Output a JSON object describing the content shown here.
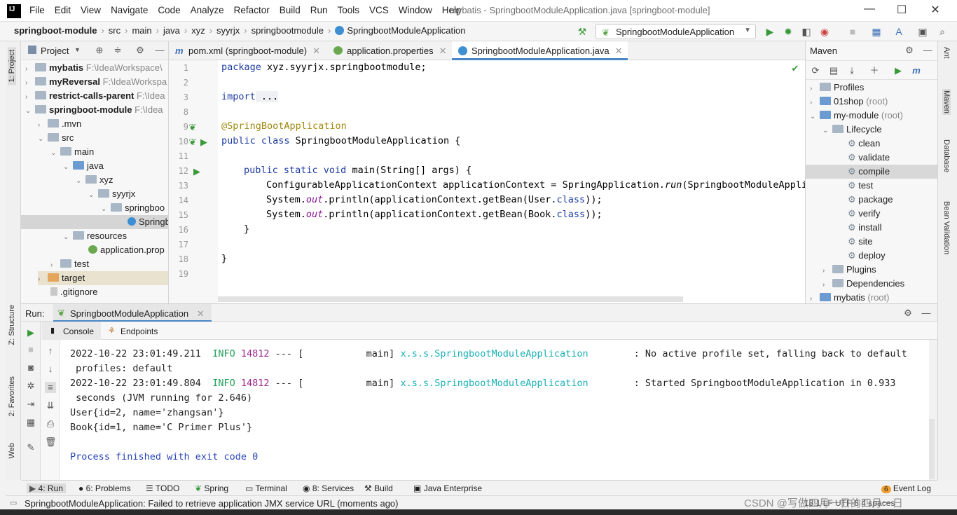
{
  "window": {
    "title": "mybatis - SpringbootModuleApplication.java [springboot-module]",
    "menu": [
      "File",
      "Edit",
      "View",
      "Navigate",
      "Code",
      "Analyze",
      "Refactor",
      "Build",
      "Run",
      "Tools",
      "VCS",
      "Window",
      "Help"
    ]
  },
  "breadcrumbs": [
    "springboot-module",
    "src",
    "main",
    "java",
    "xyz",
    "syyrjx",
    "springbootmodule",
    "SpringbootModuleApplication"
  ],
  "run_config": "SpringbootModuleApplication",
  "left_stripe": [
    "1: Project",
    "Z: Structure",
    "2: Favorites",
    "Web"
  ],
  "project": {
    "title": "Project",
    "rows": [
      {
        "label": "mybatis",
        "path": "F:\\IdeaWorkspace\\",
        "bold": true
      },
      {
        "label": "myReversal",
        "path": "F:\\IdeaWorkspa",
        "bold": true
      },
      {
        "label": "restrict-calls-parent",
        "path": "F:\\Idea",
        "bold": true
      },
      {
        "label": "springboot-module",
        "path": "F:\\Idea",
        "bold": true
      },
      {
        "label": ".mvn"
      },
      {
        "label": "src"
      },
      {
        "label": "main"
      },
      {
        "label": "java"
      },
      {
        "label": "xyz"
      },
      {
        "label": "syyrjx"
      },
      {
        "label": "springboo"
      },
      {
        "label": "Springb"
      },
      {
        "label": "resources"
      },
      {
        "label": "application.prop"
      },
      {
        "label": "test"
      },
      {
        "label": "target"
      },
      {
        "label": ".gitignore"
      }
    ]
  },
  "editor": {
    "tabs": [
      "pom.xml (springboot-module)",
      "application.properties",
      "SpringbootModuleApplication.java"
    ],
    "line_numbers": [
      "1",
      "2",
      "3",
      "8",
      "9",
      "10",
      "11",
      "12",
      "13",
      "14",
      "15",
      "16",
      "17",
      "18",
      "19"
    ],
    "code": {
      "l1_kw": "package",
      "l1_rest": " xyz.syyrjx.springbootmodule;",
      "l3_kw": "import",
      "l3_rest": " ...",
      "l9": "@SpringBootApplication",
      "l10_kw": "public class",
      "l10_rest": " SpringbootModuleApplication {",
      "l12_kw": "public static void",
      "l12_rest": " main(String[] args) {",
      "l13_a": "ConfigurableApplicationContext applicationContext = SpringApplication.",
      "l13_b": "run",
      "l13_c": "(SpringbootModuleApplic",
      "l14_a": "System.",
      "l14_out": "out",
      "l14_b": ".println(applicationContext.getBean(User.",
      "l14_cls": "class",
      "l14_c": "));",
      "l15_a": "System.",
      "l15_out": "out",
      "l15_b": ".println(applicationContext.getBean(Book.",
      "l15_cls": "class",
      "l15_c": "));",
      "l16": "}",
      "l18": "}"
    }
  },
  "maven": {
    "title": "Maven",
    "rows": [
      {
        "label": "Profiles"
      },
      {
        "label": "01shop",
        "suffix": "(root)"
      },
      {
        "label": "my-module",
        "suffix": "(root)"
      },
      {
        "label": "Lifecycle"
      },
      {
        "label": "clean"
      },
      {
        "label": "validate"
      },
      {
        "label": "compile"
      },
      {
        "label": "test"
      },
      {
        "label": "package"
      },
      {
        "label": "verify"
      },
      {
        "label": "install"
      },
      {
        "label": "site"
      },
      {
        "label": "deploy"
      },
      {
        "label": "Plugins"
      },
      {
        "label": "Dependencies"
      },
      {
        "label": "mybatis",
        "suffix": "(root)"
      }
    ]
  },
  "right_stripe": [
    "Ant",
    "Maven",
    "Database",
    "Bean Validation"
  ],
  "run": {
    "label": "Run:",
    "tab": "SpringbootModuleApplication",
    "subtabs": [
      "Console",
      "Endpoints"
    ],
    "lines": {
      "a_ts": "2022-10-22 23:01:49.211",
      "a_lvl": "INFO",
      "a_pid": "14812",
      "a_mid": " --- [           main] ",
      "a_logger": "x.s.s.SpringbootModuleApplication",
      "a_msg": "        : No active profile set, falling back to default",
      "a_cont": " profiles: default",
      "b_ts": "2022-10-22 23:01:49.804",
      "b_lvl": "INFO",
      "b_pid": "14812",
      "b_mid": " --- [           main] ",
      "b_logger": "x.s.s.SpringbootModuleApplication",
      "b_msg": "        : Started SpringbootModuleApplication in 0.933",
      "b_cont": " seconds (JVM running for 2.646)",
      "user": "User{id=2, name='zhangsan'}",
      "book": "Book{id=1, name='C Primer Plus'}",
      "process": "Process finished with exit code 0"
    }
  },
  "bottom_tools": [
    "4: Run",
    "6: Problems",
    "TODO",
    "Spring",
    "Terminal",
    "8: Services",
    "Build",
    "Java Enterprise"
  ],
  "event_log": {
    "count": "6",
    "label": "Event Log"
  },
  "status": {
    "message": "SpringbootModuleApplication: Failed to retrieve application JMX service URL (moments ago)",
    "right": "18:1  LF  UTF-8  4 spaces",
    "watermark": "CSDN @写做四月一日的四月一日"
  }
}
